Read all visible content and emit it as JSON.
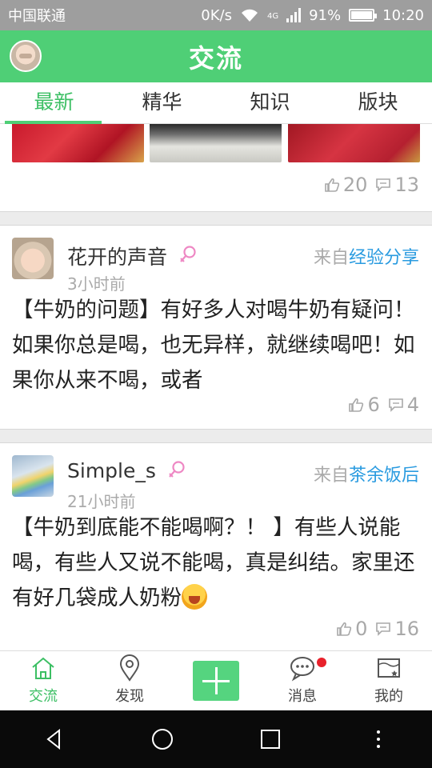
{
  "status_bar": {
    "carrier": "中国联通",
    "speed": "0K/s",
    "network": "4G",
    "battery": "91%",
    "time": "10:20"
  },
  "app_bar": {
    "title": "交流"
  },
  "tabs": [
    {
      "label": "最新",
      "active": true
    },
    {
      "label": "精华",
      "active": false
    },
    {
      "label": "知识",
      "active": false
    },
    {
      "label": "版块",
      "active": false
    }
  ],
  "posts": [
    {
      "likes": "20",
      "comments": "13"
    },
    {
      "author": "花开的声音",
      "time": "3小时前",
      "source_prefix": "来自",
      "forum": "经验分享",
      "content": "【牛奶的问题】有好多人对喝牛奶有疑问！如果你总是喝，也无异样，就继续喝吧！如果你从来不喝，或者",
      "likes": "6",
      "comments": "4"
    },
    {
      "author": "Simple_s",
      "time": "21小时前",
      "source_prefix": "来自",
      "forum": "茶余饭后",
      "content": "【牛奶到底能不能喝啊？！ 】有些人说能喝，有些人又说不能喝，真是纠结。家里还有好几袋成人奶粉",
      "likes": "0",
      "comments": "16"
    }
  ],
  "bottom_nav": [
    {
      "label": "交流",
      "icon": "home-icon",
      "active": true
    },
    {
      "label": "发现",
      "icon": "location-pin-icon"
    },
    {
      "label": "",
      "icon": "plus-icon"
    },
    {
      "label": "消息",
      "icon": "chat-bubble-icon",
      "badge": true
    },
    {
      "label": "我的",
      "icon": "profile-card-icon"
    }
  ],
  "colors": {
    "brand_green": "#4fcf76",
    "link_blue": "#2a9be0",
    "badge_red": "#e8212b"
  }
}
